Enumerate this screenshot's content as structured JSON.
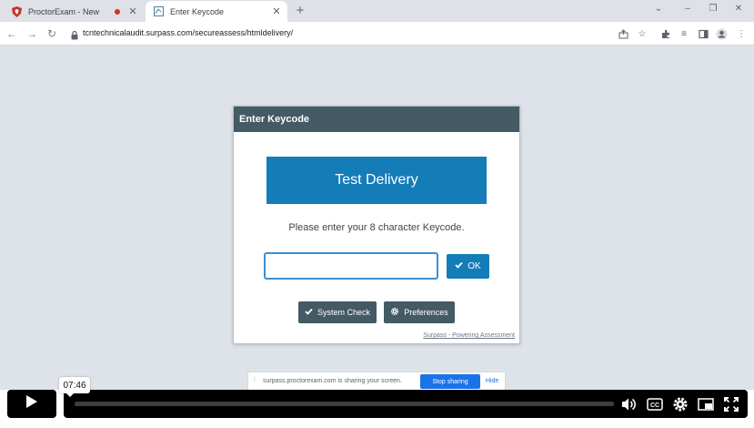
{
  "browser": {
    "tabs": [
      {
        "title": "ProctorExam - New",
        "favicon": "proctorexam-shield-icon",
        "recording": true
      },
      {
        "title": "Enter Keycode",
        "favicon": "surpass-page-icon",
        "active": true
      }
    ],
    "url": "tcntechnicalaudit.surpass.com/secureassess/htmldelivery/"
  },
  "modal": {
    "title": "Enter Keycode",
    "banner": "Test Delivery",
    "prompt": "Please enter your 8 character Keycode.",
    "keycode_value": "",
    "ok_label": "OK",
    "system_check_label": "System Check",
    "preferences_label": "Preferences",
    "footer_link": "Surpass - Powering Assessment"
  },
  "share_bar": {
    "message": "surpass.proctorexam.com is sharing your screen.",
    "stop_label": "Stop sharing",
    "hide_label": "Hide"
  },
  "player": {
    "time": "07:46"
  },
  "colors": {
    "header": "#445a64",
    "accent": "#147db8",
    "page_bg": "#dde3e9"
  }
}
